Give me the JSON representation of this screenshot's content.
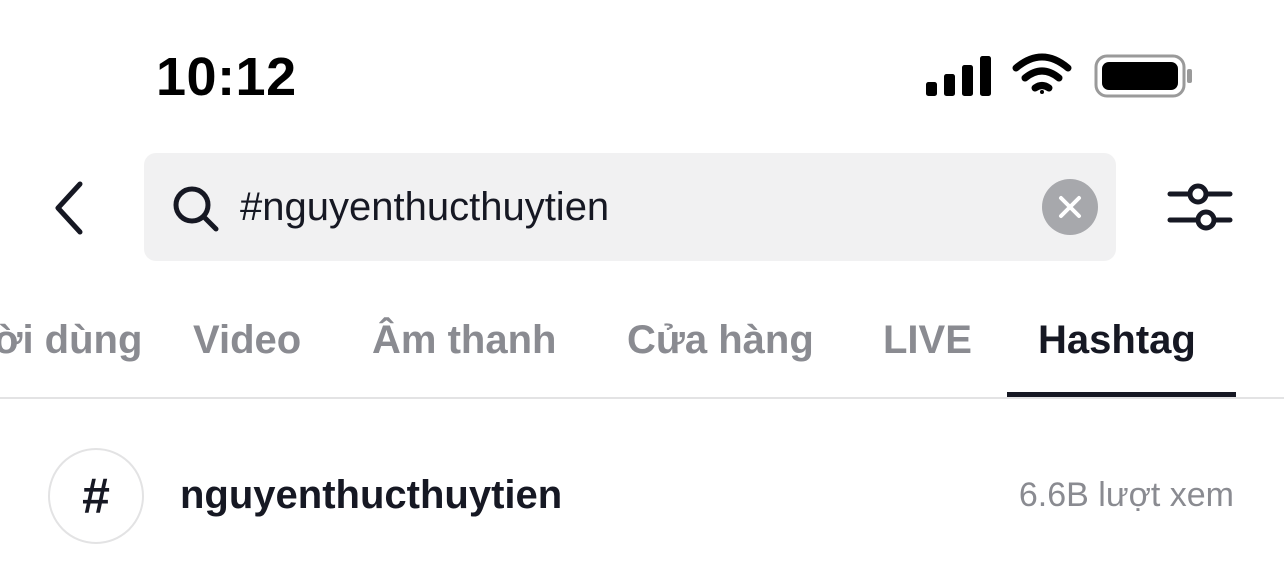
{
  "status_bar": {
    "time": "10:12",
    "icons": [
      "cellular-signal-icon",
      "wifi-icon",
      "battery-icon"
    ]
  },
  "header": {
    "back_icon": "chevron-left-icon",
    "search": {
      "icon": "search-icon",
      "value": "#nguyenthucthuytien",
      "clear_icon": "close-icon"
    },
    "filter_icon": "sliders-icon"
  },
  "tabs": {
    "items": [
      {
        "label": "ời dùng"
      },
      {
        "label": "Video"
      },
      {
        "label": "Âm thanh"
      },
      {
        "label": "Cửa hàng"
      },
      {
        "label": "LIVE"
      },
      {
        "label": "Hashtag"
      }
    ],
    "active": "Hashtag"
  },
  "results": [
    {
      "symbol": "#",
      "name": "nguyenthucthuytien",
      "views": "6.6B lượt xem"
    }
  ],
  "colors": {
    "text_primary": "#161823",
    "text_secondary": "#8a8b91",
    "search_bg": "#f1f1f2",
    "clear_bg": "#a7a8ac",
    "divider": "#e3e3e4"
  }
}
